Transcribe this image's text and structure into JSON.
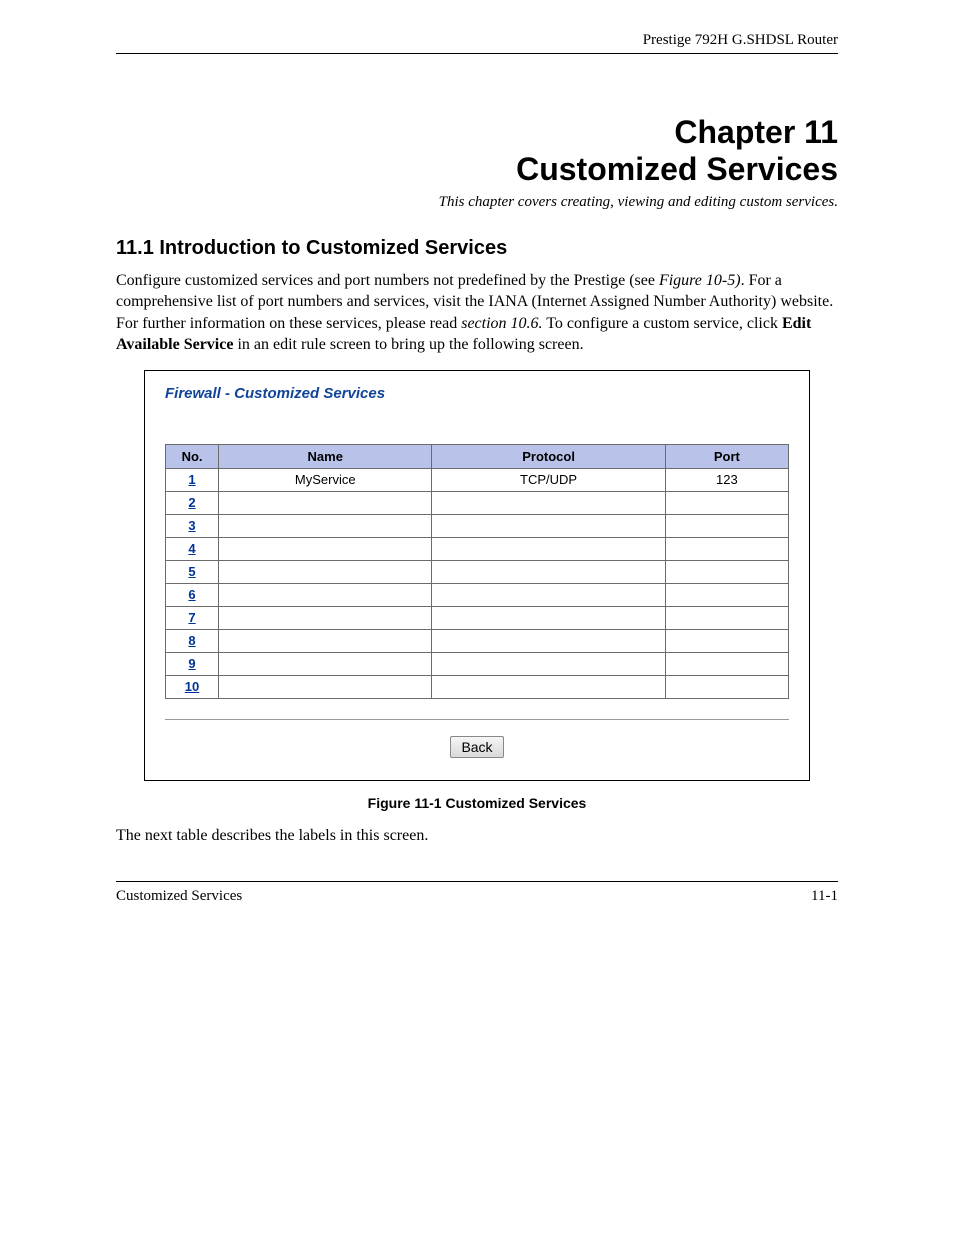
{
  "header": {
    "title": "Prestige 792H G.SHDSL Router"
  },
  "chapter": {
    "line1": "Chapter 11",
    "line2": "Customized Services",
    "intro": "This chapter covers creating, viewing and editing custom services."
  },
  "section": {
    "heading": "11.1  Introduction to Customized Services",
    "para_a": "Configure customized services and port numbers not predefined by the Prestige (see ",
    "para_ref1": "Figure 10-5)",
    "para_b": ".  For a comprehensive list of port numbers and services, visit the IANA (Internet Assigned Number Authority) website.  For further information on these services, please read ",
    "para_ref2": "section 10.6.",
    "para_c": "  To configure a custom service, click ",
    "para_bold": "Edit Available Service",
    "para_d": " in an edit rule screen to bring up the following screen."
  },
  "figure": {
    "title": "Firewall - Customized Services",
    "columns": {
      "no": "No.",
      "name": "Name",
      "protocol": "Protocol",
      "port": "Port"
    },
    "rows": [
      {
        "no": "1",
        "name": "MyService",
        "protocol": "TCP/UDP",
        "port": "123"
      },
      {
        "no": "2",
        "name": "",
        "protocol": "",
        "port": ""
      },
      {
        "no": "3",
        "name": "",
        "protocol": "",
        "port": ""
      },
      {
        "no": "4",
        "name": "",
        "protocol": "",
        "port": ""
      },
      {
        "no": "5",
        "name": "",
        "protocol": "",
        "port": ""
      },
      {
        "no": "6",
        "name": "",
        "protocol": "",
        "port": ""
      },
      {
        "no": "7",
        "name": "",
        "protocol": "",
        "port": ""
      },
      {
        "no": "8",
        "name": "",
        "protocol": "",
        "port": ""
      },
      {
        "no": "9",
        "name": "",
        "protocol": "",
        "port": ""
      },
      {
        "no": "10",
        "name": "",
        "protocol": "",
        "port": ""
      }
    ],
    "back_label": "Back",
    "caption": "Figure 11-1 Customized Services"
  },
  "after_figure": "The next table describes the labels in this screen.",
  "footer": {
    "left": "Customized Services",
    "right": "11-1"
  }
}
